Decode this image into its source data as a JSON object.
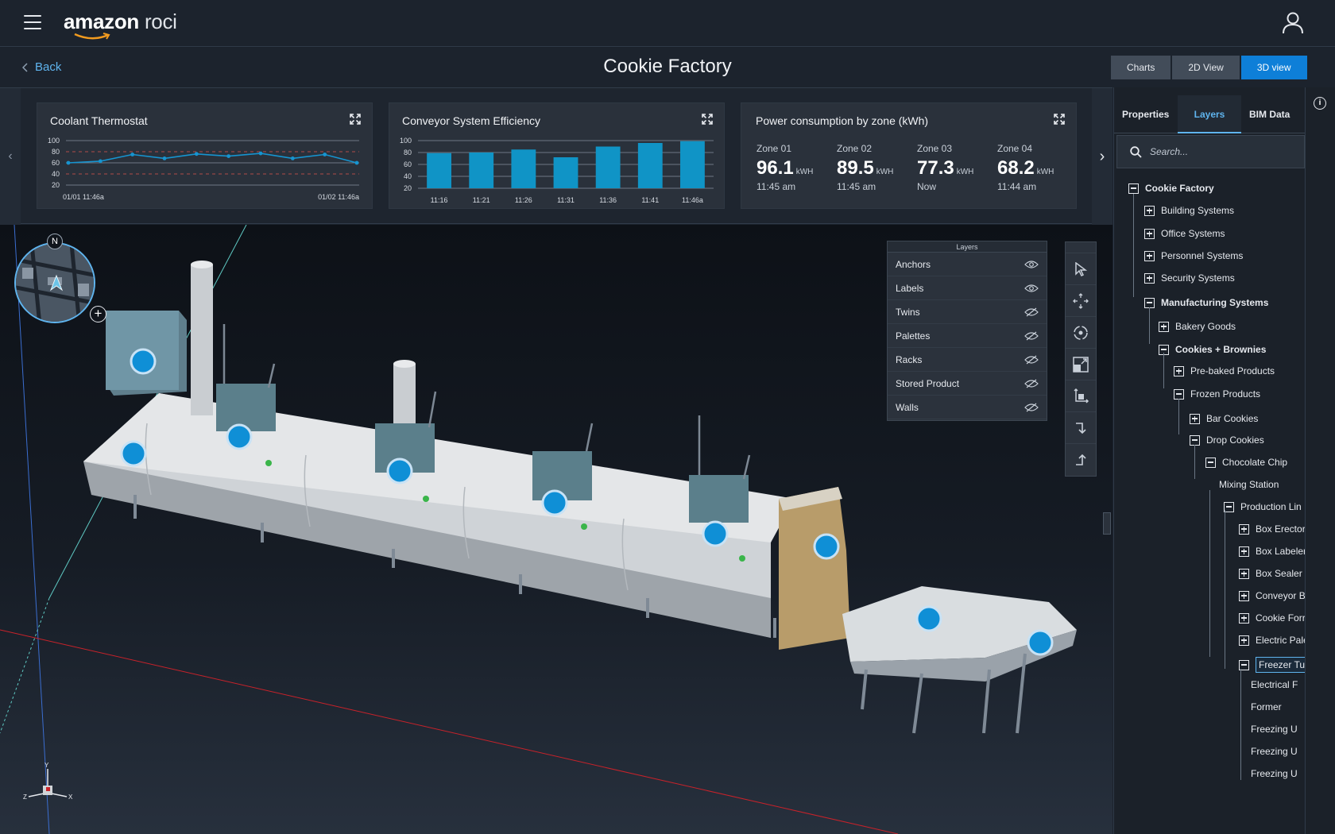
{
  "app": {
    "brand_bold": "amazon",
    "brand_light": " roci"
  },
  "header": {
    "back_label": "Back",
    "page_title": "Cookie Factory"
  },
  "view_tabs": [
    {
      "label": "Charts"
    },
    {
      "label": "2D View"
    },
    {
      "label": "3D view",
      "active": true
    }
  ],
  "cards": {
    "thermostat": {
      "title": "Coolant Thermostat",
      "y_ticks": [
        "100",
        "80",
        "60",
        "40",
        "20"
      ],
      "x_start": "01/01 11:46a",
      "x_end": "01/02 11:46a",
      "values": [
        60,
        63,
        75,
        68,
        76,
        72,
        77,
        68,
        75,
        60
      ]
    },
    "conveyor": {
      "title": "Conveyor System Efficiency",
      "y_ticks": [
        "100",
        "80",
        "60",
        "40",
        "20"
      ],
      "categories": [
        "11:16",
        "11:21",
        "11:26",
        "11:31",
        "11:36",
        "11:41",
        "11:46a"
      ],
      "values": [
        79,
        80,
        85,
        72,
        90,
        96,
        99
      ]
    },
    "power": {
      "title": "Power consumption by zone (kWh)",
      "unit": "kWH",
      "zones": [
        {
          "name": "Zone 01",
          "value": "96.1",
          "time": "11:45 am"
        },
        {
          "name": "Zone 02",
          "value": "89.5",
          "time": "11:45 am"
        },
        {
          "name": "Zone 03",
          "value": "77.3",
          "time": "Now"
        },
        {
          "name": "Zone 04",
          "value": "68.2",
          "time": "11:44 am"
        }
      ]
    }
  },
  "compass": {
    "north": "N"
  },
  "layers_panel": {
    "title": "Layers",
    "items": [
      {
        "label": "Anchors",
        "visible": true
      },
      {
        "label": "Labels",
        "visible": true
      },
      {
        "label": "Twins",
        "visible": false
      },
      {
        "label": "Palettes",
        "visible": false
      },
      {
        "label": "Racks",
        "visible": false
      },
      {
        "label": "Stored Product",
        "visible": false
      },
      {
        "label": "Walls",
        "visible": false
      }
    ]
  },
  "axes_gizmo": {
    "y": "Y",
    "z": "Z",
    "x": "X"
  },
  "right_panel": {
    "tabs": [
      {
        "label": "Properties"
      },
      {
        "label": "Layers",
        "active": true
      },
      {
        "label": "BIM Data"
      }
    ],
    "search_placeholder": "Search...",
    "tree": [
      {
        "label": "Cookie Factory",
        "icon": "minus",
        "bold": true
      },
      {
        "label": "Building Systems",
        "icon": "plus"
      },
      {
        "label": "Office Systems",
        "icon": "plus"
      },
      {
        "label": "Personnel Systems",
        "icon": "plus"
      },
      {
        "label": "Security Systems",
        "icon": "plus"
      },
      {
        "label": "Manufacturing Systems",
        "icon": "minus",
        "bold": true
      },
      {
        "label": "Bakery Goods",
        "icon": "plus"
      },
      {
        "label": "Cookies + Brownies",
        "icon": "minus",
        "bold": true
      },
      {
        "label": "Pre-baked Products",
        "icon": "plus"
      },
      {
        "label": "Frozen Products",
        "icon": "minus"
      },
      {
        "label": "Bar Cookies",
        "icon": "plus"
      },
      {
        "label": "Drop Cookies",
        "icon": "minus"
      },
      {
        "label": "Chocolate Chip",
        "icon": "minus"
      },
      {
        "label": "Mixing Station",
        "icon": "none"
      },
      {
        "label": "Production Lin",
        "icon": "minus"
      },
      {
        "label": "Box Erector",
        "icon": "plus"
      },
      {
        "label": "Box Labeler",
        "icon": "plus"
      },
      {
        "label": "Box Sealer",
        "icon": "plus"
      },
      {
        "label": "Conveyor B",
        "icon": "plus"
      },
      {
        "label": "Cookie Forr",
        "icon": "plus"
      },
      {
        "label": "Electric Pale",
        "icon": "plus"
      },
      {
        "label": "Freezer Tun",
        "icon": "minus",
        "selected": true
      },
      {
        "label": "Electrical F",
        "icon": "none"
      },
      {
        "label": "Former",
        "icon": "none"
      },
      {
        "label": "Freezing U",
        "icon": "none"
      },
      {
        "label": "Freezing U",
        "icon": "none"
      },
      {
        "label": "Freezing U",
        "icon": "none"
      }
    ]
  },
  "colors": {
    "accent": "#0e7fd8",
    "link": "#5fb4ee",
    "bar": "#1094c6",
    "anchor": "#0f8fd6"
  }
}
